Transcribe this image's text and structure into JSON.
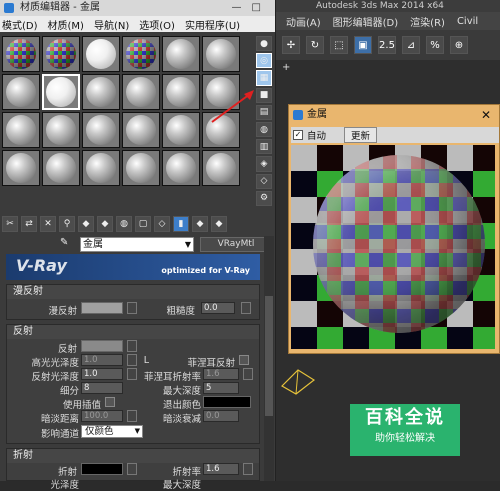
{
  "max_window": {
    "title": "Autodesk 3ds Max  2014 x64",
    "menu": [
      "动画(A)",
      "图形编辑器(D)",
      "渲染(R)",
      "Civil"
    ],
    "toolbar": [
      "✢",
      "↻",
      "⬚",
      "▣",
      "2.5",
      "⊿",
      "%",
      "⊕"
    ],
    "viewport_label": "+"
  },
  "editor": {
    "title": "材质编辑器 - 金属",
    "menu": [
      "模式(D)",
      "材质(M)",
      "导航(N)",
      "选项(O)",
      "实用程序(U)"
    ],
    "slots": [
      {
        "type": "checker"
      },
      {
        "type": "checker"
      },
      {
        "type": "white"
      },
      {
        "type": "checker"
      },
      {
        "type": "plain"
      },
      {
        "type": "plain"
      },
      {
        "type": "plain"
      },
      {
        "type": "white-active"
      },
      {
        "type": "plain"
      },
      {
        "type": "plain"
      },
      {
        "type": "plain"
      },
      {
        "type": "plain"
      },
      {
        "type": "plain"
      },
      {
        "type": "plain"
      },
      {
        "type": "plain"
      },
      {
        "type": "plain"
      },
      {
        "type": "plain"
      },
      {
        "type": "plain"
      },
      {
        "type": "plain"
      },
      {
        "type": "plain"
      },
      {
        "type": "plain"
      },
      {
        "type": "plain"
      },
      {
        "type": "plain"
      },
      {
        "type": "plain"
      }
    ],
    "side_tools": [
      "●",
      "◎",
      "▦",
      "■",
      "▤",
      "◍",
      "▥",
      "◈",
      "◇",
      "⚙"
    ],
    "bottom_tools": [
      "✂",
      "⇄",
      "✕",
      "⚲",
      "◆",
      "◆",
      "◍",
      "▢",
      "◇",
      "▮",
      "◆",
      "◆"
    ],
    "material_name": "金属",
    "material_type": "VRayMtl",
    "vray_logo": "V-Ray",
    "vray_tagline": "optimized for V-Ray",
    "diffuse_section": {
      "header": "漫反射",
      "diffuse_label": "漫反射",
      "roughness_label": "粗糙度",
      "roughness_value": "0.0"
    },
    "reflection_section": {
      "header": "反射",
      "reflect_label": "反射",
      "hilight_gloss_label": "高光光泽度",
      "hilight_gloss_value": "1.0",
      "l_button": "L",
      "fresnel_label": "菲涅耳反射",
      "refl_gloss_label": "反射光泽度",
      "refl_gloss_value": "1.0",
      "fresnel_ior_label": "菲涅耳折射率",
      "fresnel_ior_value": "1.6",
      "subdivs_label": "细分",
      "subdivs_value": "8",
      "max_depth_label": "最大深度",
      "max_depth_value": "5",
      "use_interp_label": "使用插值",
      "exit_color_label": "退出颜色",
      "dim_dist_label": "暗淡距离",
      "dim_dist_value": "100.0",
      "dim_falloff_label": "暗淡衰减",
      "dim_falloff_value": "0.0",
      "affect_channels_label": "影响通道",
      "affect_channels_value": "仅颜色"
    },
    "refraction_section": {
      "header": "折射",
      "refract_label": "折射",
      "ior_label": "折射率",
      "ior_value": "1.6",
      "gloss_label": "光泽度",
      "max_depth_label": "最大深度"
    }
  },
  "preview": {
    "title": "金属",
    "auto_label": "自动",
    "update_label": "更新"
  },
  "watermark": {
    "title": "百科全说",
    "subtitle": "助你轻松解决"
  },
  "colors": {
    "accent_blue": "#3d6fa8",
    "preview_frame": "#e9b66e",
    "watermark_green": "#2ab36e",
    "annotation_red": "#e02020"
  }
}
